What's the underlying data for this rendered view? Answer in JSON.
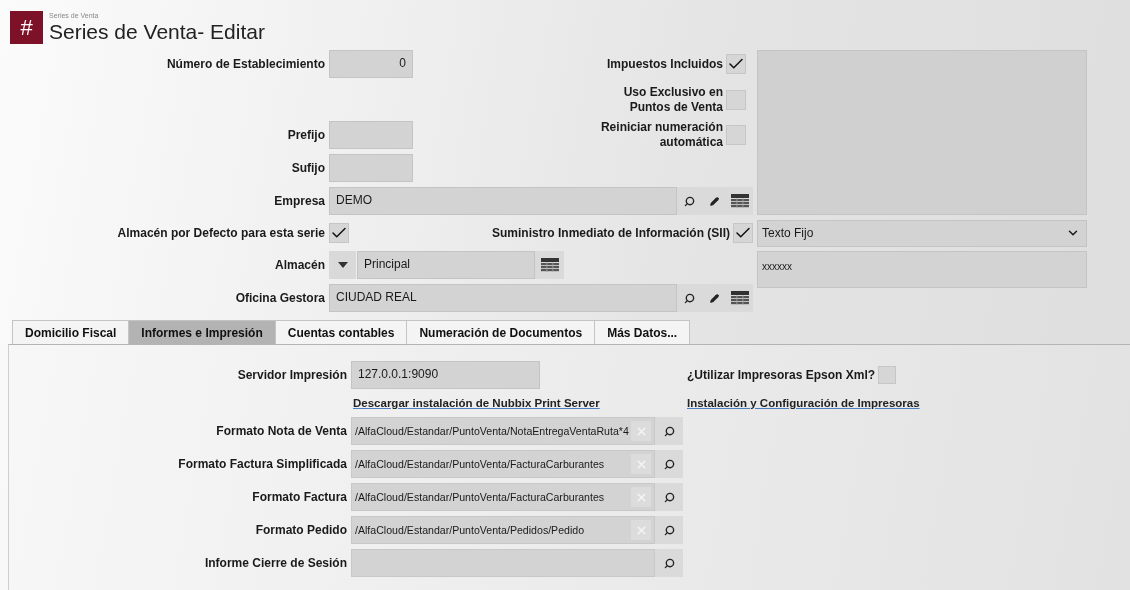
{
  "header": {
    "icon_glyph": "#",
    "breadcrumb": "Series de Venta",
    "title": "Series de Venta- Editar"
  },
  "numero_establecimiento": {
    "label": "Número de Establecimiento",
    "value": "0"
  },
  "impuestos_incluidos": {
    "label": "Impuestos Incluidos",
    "checked": true
  },
  "uso_exclusivo": {
    "label": "Uso Exclusivo en Puntos de Venta",
    "checked": false
  },
  "reiniciar_numeracion": {
    "label": "Reiniciar numeración automática",
    "checked": false
  },
  "prefijo": {
    "label": "Prefijo"
  },
  "sufijo": {
    "label": "Sufijo"
  },
  "empresa": {
    "label": "Empresa",
    "value": "DEMO"
  },
  "almacen_defecto": {
    "label": "Almacén por Defecto para esta serie",
    "checked": true
  },
  "sii": {
    "label": "Suministro Inmediato de Información (SII)",
    "checked": true
  },
  "sii_mode": {
    "value": "Texto Fijo"
  },
  "sii_text": {
    "value": "xxxxxx"
  },
  "almacen": {
    "label": "Almacén",
    "value": "Principal"
  },
  "oficina_gestora": {
    "label": "Oficina Gestora",
    "value": "CIUDAD REAL"
  },
  "tabs": [
    {
      "label": "Domicilio Fiscal",
      "selected": false
    },
    {
      "label": "Informes e Impresión",
      "selected": true
    },
    {
      "label": "Cuentas contables",
      "selected": false
    },
    {
      "label": "Numeración de Documentos",
      "selected": false
    },
    {
      "label": "Más Datos...",
      "selected": false
    }
  ],
  "impresion": {
    "servidor": {
      "label": "Servidor Impresión",
      "value": "127.0.0.1:9090"
    },
    "epson": {
      "label": "¿Utilizar Impresoras Epson Xml?",
      "checked": false
    },
    "download_link": "Descargar instalación de Nubbix Print Server",
    "config_link": "Instalación y Configuración de Impresoras",
    "formats": [
      {
        "label": "Formato Nota de Venta",
        "value": "/AlfaCloud/Estandar/PuntoVenta/NotaEntregaVentaRuta*4",
        "clearable": true
      },
      {
        "label": "Formato Factura Simplificada",
        "value": "/AlfaCloud/Estandar/PuntoVenta/FacturaCarburantes",
        "clearable": true
      },
      {
        "label": "Formato Factura",
        "value": "/AlfaCloud/Estandar/PuntoVenta/FacturaCarburantes",
        "clearable": true
      },
      {
        "label": "Formato Pedido",
        "value": "/AlfaCloud/Estandar/PuntoVenta/Pedidos/Pedido",
        "clearable": true
      },
      {
        "label": "Informe Cierre de Sesión",
        "clearable": false
      }
    ]
  }
}
